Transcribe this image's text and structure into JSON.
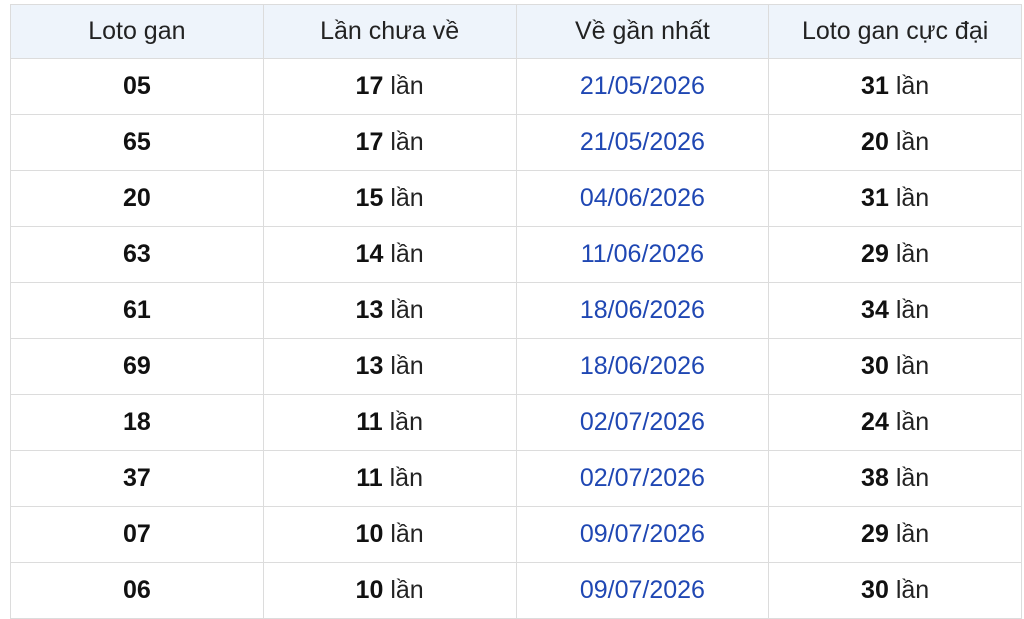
{
  "table": {
    "headers": [
      "Loto gan",
      "Lần chưa về",
      "Về gần nhất",
      "Loto gan cực đại"
    ],
    "unit": "lần",
    "rows": [
      {
        "loto": "05",
        "missing": "17",
        "last": "21/05/2026",
        "max": "31"
      },
      {
        "loto": "65",
        "missing": "17",
        "last": "21/05/2026",
        "max": "20"
      },
      {
        "loto": "20",
        "missing": "15",
        "last": "04/06/2026",
        "max": "31"
      },
      {
        "loto": "63",
        "missing": "14",
        "last": "11/06/2026",
        "max": "29"
      },
      {
        "loto": "61",
        "missing": "13",
        "last": "18/06/2026",
        "max": "34"
      },
      {
        "loto": "69",
        "missing": "13",
        "last": "18/06/2026",
        "max": "30"
      },
      {
        "loto": "18",
        "missing": "11",
        "last": "02/07/2026",
        "max": "24"
      },
      {
        "loto": "37",
        "missing": "11",
        "last": "02/07/2026",
        "max": "38"
      },
      {
        "loto": "07",
        "missing": "10",
        "last": "09/07/2026",
        "max": "29"
      },
      {
        "loto": "06",
        "missing": "10",
        "last": "09/07/2026",
        "max": "30"
      }
    ]
  },
  "colors": {
    "header_bg": "#eef4fb",
    "date_link": "#1f47b3",
    "border": "#dcdcdc"
  }
}
